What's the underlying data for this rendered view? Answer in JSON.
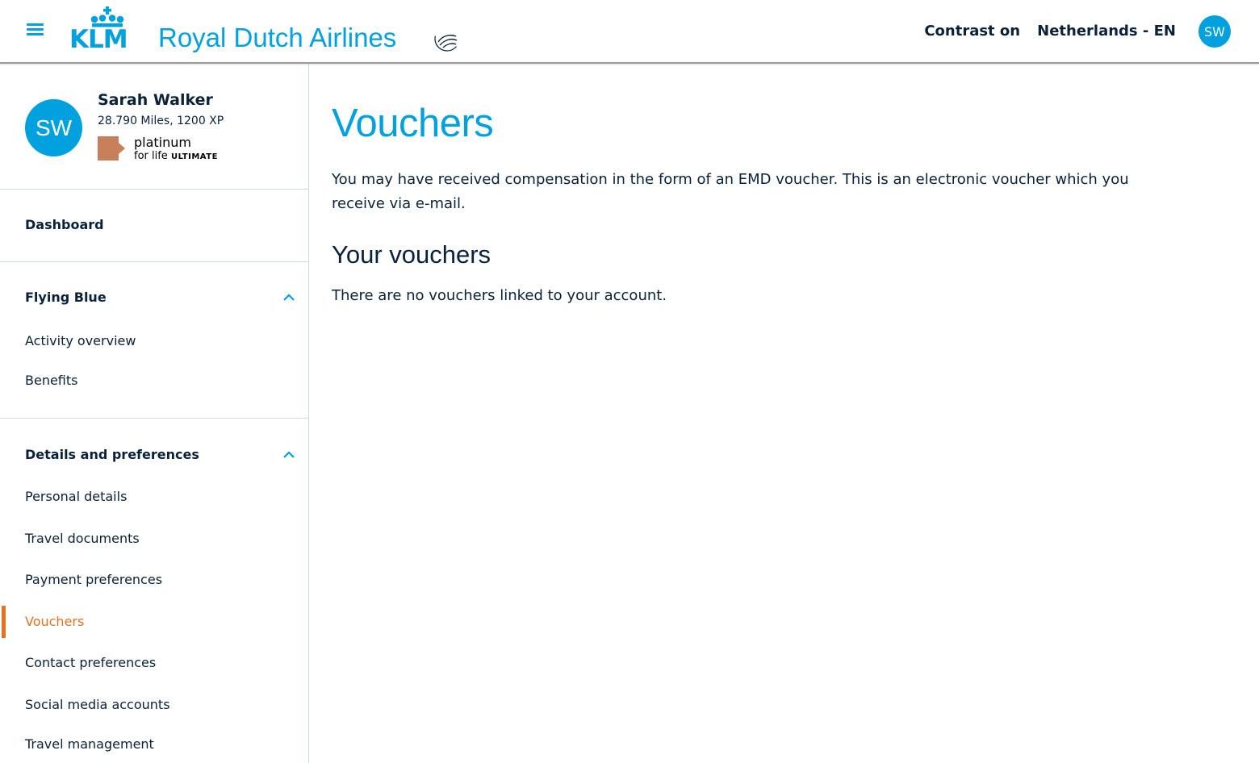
{
  "header": {
    "brand": "KLM",
    "brand_full": "Royal Dutch Airlines",
    "contrast_label": "Contrast on",
    "locale_label": "Netherlands - EN",
    "user_initials": "SW",
    "icons": [
      "menu-icon",
      "klm-crown-logo",
      "skyteam-logo"
    ],
    "brand_color": "#00a1de"
  },
  "profile": {
    "initials": "SW",
    "name": "Sarah Walker",
    "stats": "28.790 Miles, 1200 XP",
    "tier_main": "platinum",
    "tier_sub_prefix": "for life",
    "tier_sub_suffix": "ULTIMATE",
    "tier_color": "#c8805a"
  },
  "sidebar": {
    "dashboard": "Dashboard",
    "flying_blue": {
      "title": "Flying Blue",
      "items": [
        "Activity overview",
        "Benefits"
      ]
    },
    "details": {
      "title": "Details and preferences",
      "items": [
        "Personal details",
        "Travel documents",
        "Payment preferences",
        "Vouchers",
        "Contact preferences",
        "Social media accounts",
        "Travel management"
      ],
      "active": "Vouchers"
    },
    "accent_color": "#e37222"
  },
  "main": {
    "title": "Vouchers",
    "intro": "You may have received compensation in the form of an EMD voucher. This is an electronic voucher which you receive via e-mail.",
    "subtitle": "Your vouchers",
    "empty_message": "There are no vouchers linked to your account."
  }
}
